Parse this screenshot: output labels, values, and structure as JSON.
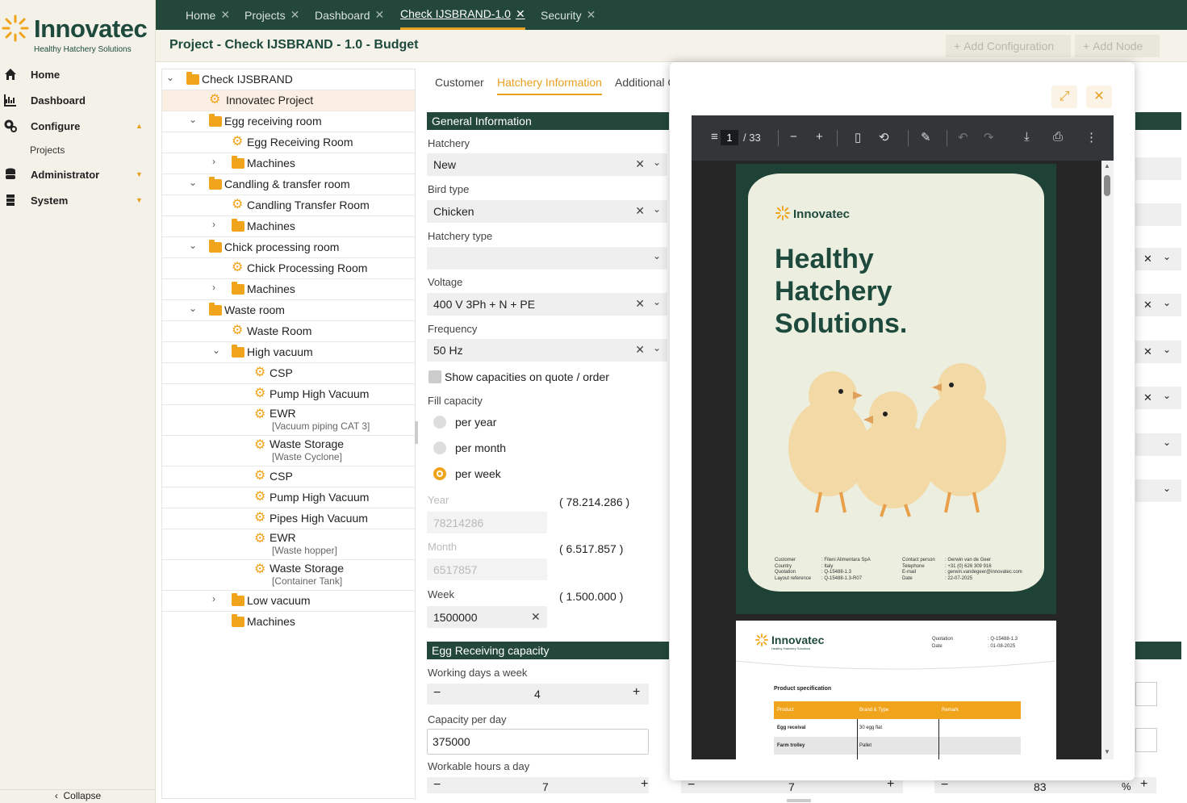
{
  "app": {
    "brand": "Innovatec",
    "tagline": "Healthy Hatchery Solutions"
  },
  "sidebar": {
    "items": [
      {
        "label": "Home",
        "icon": "home-icon"
      },
      {
        "label": "Dashboard",
        "icon": "chart-icon"
      },
      {
        "label": "Configure",
        "icon": "gears-icon"
      },
      {
        "label": "Administrator",
        "icon": "database-icon"
      },
      {
        "label": "System",
        "icon": "server-icon"
      }
    ],
    "sub_projects": "Projects",
    "collapse": "Collapse"
  },
  "tabs": [
    {
      "label": "Home"
    },
    {
      "label": "Projects"
    },
    {
      "label": "Dashboard"
    },
    {
      "label": "Check IJSBRAND-1.0"
    },
    {
      "label": "Security"
    }
  ],
  "page": {
    "title": "Project - Check IJSBRAND - 1.0 - Budget",
    "add_configuration": "Add Configuration",
    "add_node": "Add Node"
  },
  "tree": [
    {
      "label": "Check IJSBRAND"
    },
    {
      "label": "Innovatec Project"
    },
    {
      "label": "Egg receiving room"
    },
    {
      "label": "Egg Receiving Room"
    },
    {
      "label": "Machines"
    },
    {
      "label": "Candling & transfer room"
    },
    {
      "label": "Candling Transfer Room"
    },
    {
      "label": "Machines"
    },
    {
      "label": "Chick processing room"
    },
    {
      "label": "Chick Processing Room"
    },
    {
      "label": "Machines"
    },
    {
      "label": "Waste room"
    },
    {
      "label": "Waste Room"
    },
    {
      "label": "High vacuum"
    },
    {
      "label": "CSP"
    },
    {
      "label": "Pump High Vacuum"
    },
    {
      "label": "EWR",
      "sub": "[Vacuum piping CAT 3]"
    },
    {
      "label": "Waste Storage",
      "sub": "[Waste Cyclone]"
    },
    {
      "label": "CSP"
    },
    {
      "label": "Pump High Vacuum"
    },
    {
      "label": "Pipes High Vacuum"
    },
    {
      "label": "EWR",
      "sub": "[Waste hopper]"
    },
    {
      "label": "Waste Storage",
      "sub": "[Container Tank]"
    },
    {
      "label": "Low vacuum"
    },
    {
      "label": "Machines"
    }
  ],
  "form": {
    "tabs": [
      "Customer",
      "Hatchery Information",
      "Additional C"
    ],
    "general_information": "General Information",
    "hatchery_label": "Hatchery",
    "hatchery_value": "New",
    "bird_type_label": "Bird type",
    "bird_type_value": "Chicken",
    "hatchery_type_label": "Hatchery type",
    "hatchery_type_value": "",
    "voltage_label": "Voltage",
    "voltage_value": "400 V 3Ph + N + PE",
    "frequency_label": "Frequency",
    "frequency_value": "50 Hz",
    "show_capacities": "Show capacities on quote / order",
    "fill_capacity": "Fill capacity",
    "radio_year": "per year",
    "radio_month": "per month",
    "radio_week": "per week",
    "year_label": "Year",
    "year_value": "78214286",
    "year_fmt": "( 78.214.286 )",
    "month_label": "Month",
    "month_value": "6517857",
    "month_fmt": "( 6.517.857 )",
    "week_label": "Week",
    "week_value": "1500000",
    "week_fmt": "( 1.500.000 )",
    "egg_receiving_capacity": "Egg Receiving capacity",
    "working_days_label": "Working days a week",
    "working_days_value": "4",
    "capacity_per_day_label": "Capacity per day",
    "capacity_per_day_value": "375000",
    "workable_hours_label": "Workable hours a day",
    "workable_hours_value": "7",
    "bottom_value_2": "7",
    "bottom_value_3": "83",
    "percent": "%"
  },
  "viewer": {
    "page": "1",
    "total": "/ 33",
    "cover_brand": "Innovatec",
    "cover_title_1": "Healthy",
    "cover_title_2": "Hatchery",
    "cover_title_3": "Solutions.",
    "cover_info": {
      "left_labels": [
        "Customer",
        "Country",
        "Quotation",
        "Layout reference"
      ],
      "left_values": [
        ": Fileni Alimentara SpA",
        ": Italy",
        ": Q-15488-1.3",
        ": Q-15488-1.3-R07"
      ],
      "right_labels": [
        "Contact person",
        "Telephone",
        "E-mail",
        "Date"
      ],
      "right_values": [
        ": Gerwin van de Geer",
        ": +31 (0) 626 309 916",
        ": gerwin.vandegeer@innovatec.com",
        ": 22-07-2025"
      ]
    },
    "p2_brand": "Innovatec",
    "p2_tagline": "Healthy Hatchery Solutions",
    "p2_quotation_label": "Quotation",
    "p2_quotation_value": ": Q-15488-1.3",
    "p2_date_label": "Date",
    "p2_date_value": ": 01-08-2025",
    "p2_section": "Product specification",
    "p2_headers": [
      "Product",
      "Brand & Type",
      "Remark"
    ],
    "p2_rows": [
      [
        "Egg receival",
        "30 egg flat",
        ""
      ],
      [
        "Farm trolley",
        "Pallet",
        ""
      ]
    ]
  },
  "colors": {
    "brand_green": "#23473b",
    "accent_orange": "#e8a020"
  }
}
